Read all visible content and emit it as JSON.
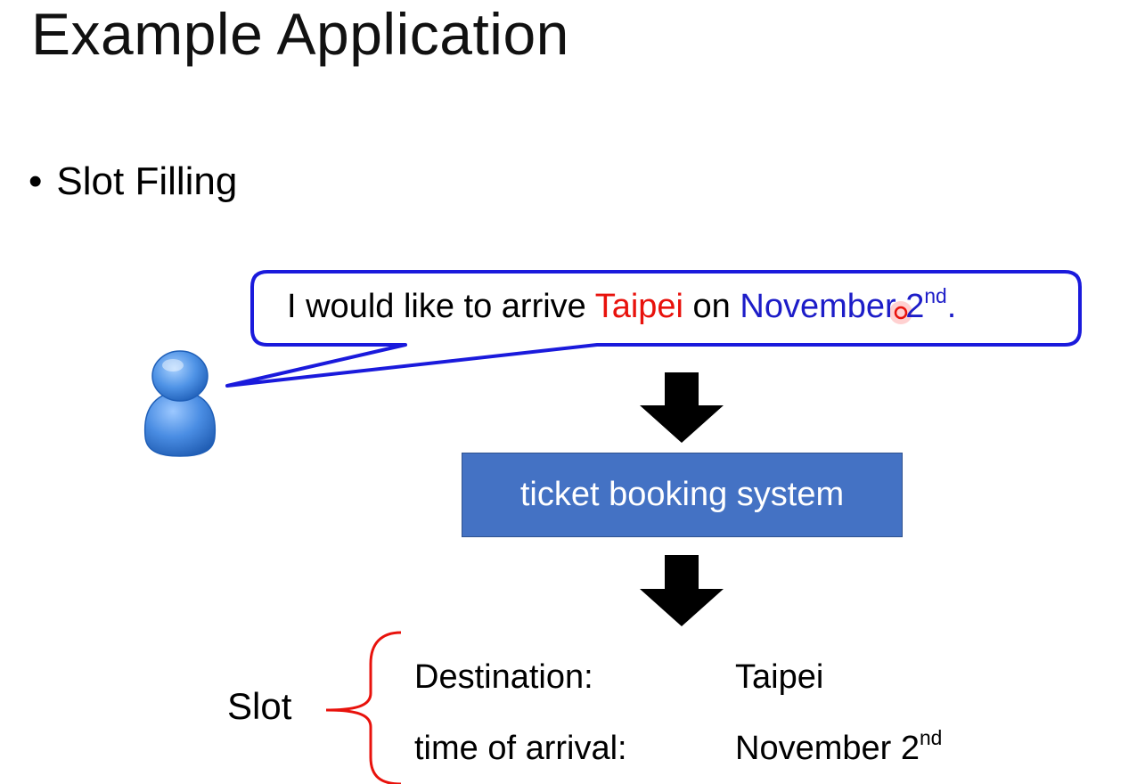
{
  "title": "Example Application",
  "bullet": {
    "marker": "•",
    "text": "Slot Filling"
  },
  "speech": {
    "part1": "I would like to arrive ",
    "city": "Taipei",
    "part2": " on ",
    "date": "November 2",
    "date_suffix": "nd",
    "period": "."
  },
  "system_box": {
    "label": "ticket booking system"
  },
  "slot": {
    "label": "Slot",
    "rows": [
      {
        "name": "Destination:",
        "value": "Taipei",
        "suffix": ""
      },
      {
        "name": "time of arrival:",
        "value": "November 2",
        "suffix": "nd"
      }
    ]
  },
  "colors": {
    "bubble_border": "#1a1adc",
    "city": "#e8120c",
    "date": "#1d1dc8",
    "box_fill": "#4472c4",
    "brace": "#e8120c",
    "person": "#3a7fd5"
  },
  "icons": {
    "person": "user-icon",
    "arrows": "down-arrow-icon"
  }
}
